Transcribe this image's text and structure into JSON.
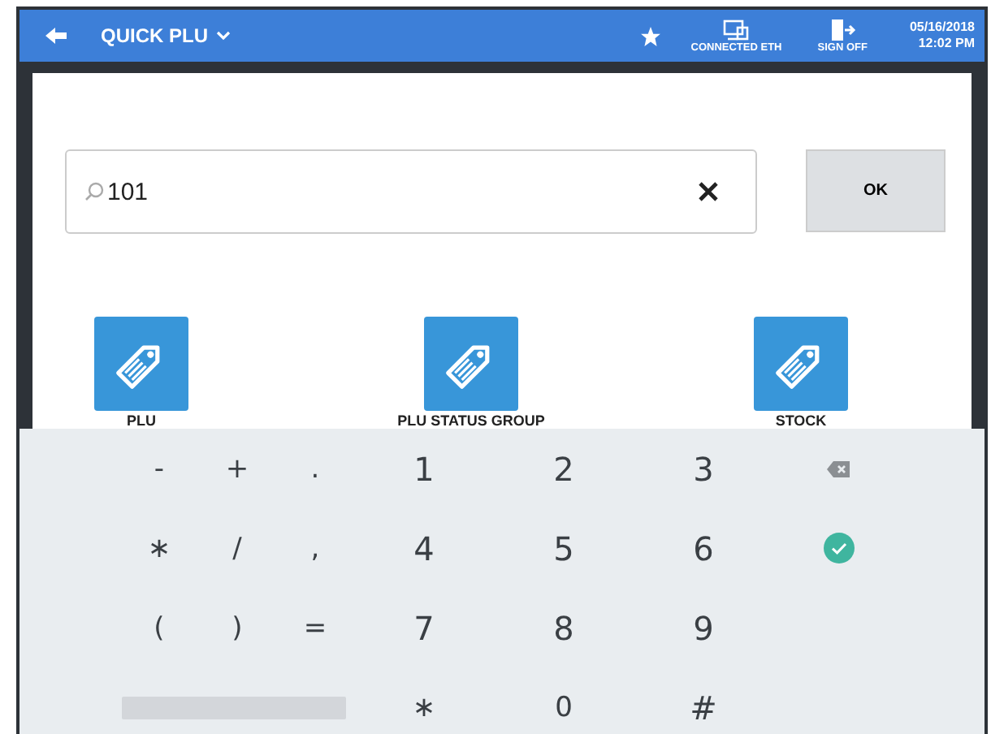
{
  "header": {
    "title": "QUICK PLU",
    "status": "CONNECTED ETH",
    "sign_off": "SIGN OFF",
    "date": "05/16/2018",
    "time": "12:02 PM"
  },
  "search": {
    "value": "101"
  },
  "ok_button": "OK",
  "tiles": [
    {
      "label": "PLU"
    },
    {
      "label": "PLU STATUS GROUP"
    },
    {
      "label": "STOCK"
    }
  ],
  "keypad": [
    [
      {
        "kind": "char",
        "label": "-"
      },
      {
        "kind": "char",
        "label": "+"
      },
      {
        "kind": "char",
        "label": "."
      },
      {
        "kind": "char",
        "label": "1"
      },
      {
        "kind": "char",
        "label": "2"
      },
      {
        "kind": "char",
        "label": "3"
      },
      {
        "kind": "backspace"
      }
    ],
    [
      {
        "kind": "char",
        "label": "∗"
      },
      {
        "kind": "char",
        "label": "/"
      },
      {
        "kind": "char",
        "label": ","
      },
      {
        "kind": "char",
        "label": "4"
      },
      {
        "kind": "char",
        "label": "5"
      },
      {
        "kind": "char",
        "label": "6"
      },
      {
        "kind": "enter"
      }
    ],
    [
      {
        "kind": "char",
        "label": "("
      },
      {
        "kind": "char",
        "label": ")"
      },
      {
        "kind": "char",
        "label": "="
      },
      {
        "kind": "char",
        "label": "7"
      },
      {
        "kind": "char",
        "label": "8"
      },
      {
        "kind": "char",
        "label": "9"
      },
      {
        "kind": "blank"
      }
    ],
    [
      {
        "kind": "space"
      },
      {
        "kind": "char",
        "label": "∗"
      },
      {
        "kind": "char",
        "label": "0"
      },
      {
        "kind": "char",
        "label": "#"
      },
      {
        "kind": "blank"
      }
    ]
  ]
}
